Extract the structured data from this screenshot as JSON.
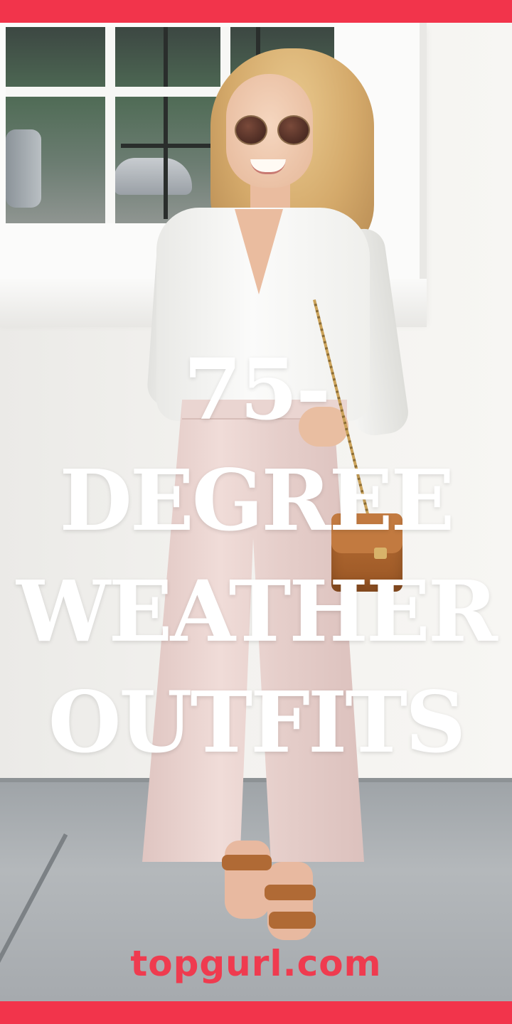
{
  "headline": {
    "line1": "75-",
    "line2": "DEGREE",
    "line3": "WEATHER",
    "line4": "OUTFITS"
  },
  "brand": {
    "text": "topgurl.com"
  },
  "colors": {
    "accent_bar": "#f2344b",
    "brand_text": "#ef3b4f",
    "headline_text": "#ffffff"
  },
  "photo": {
    "description_icon": "photo-scene"
  }
}
